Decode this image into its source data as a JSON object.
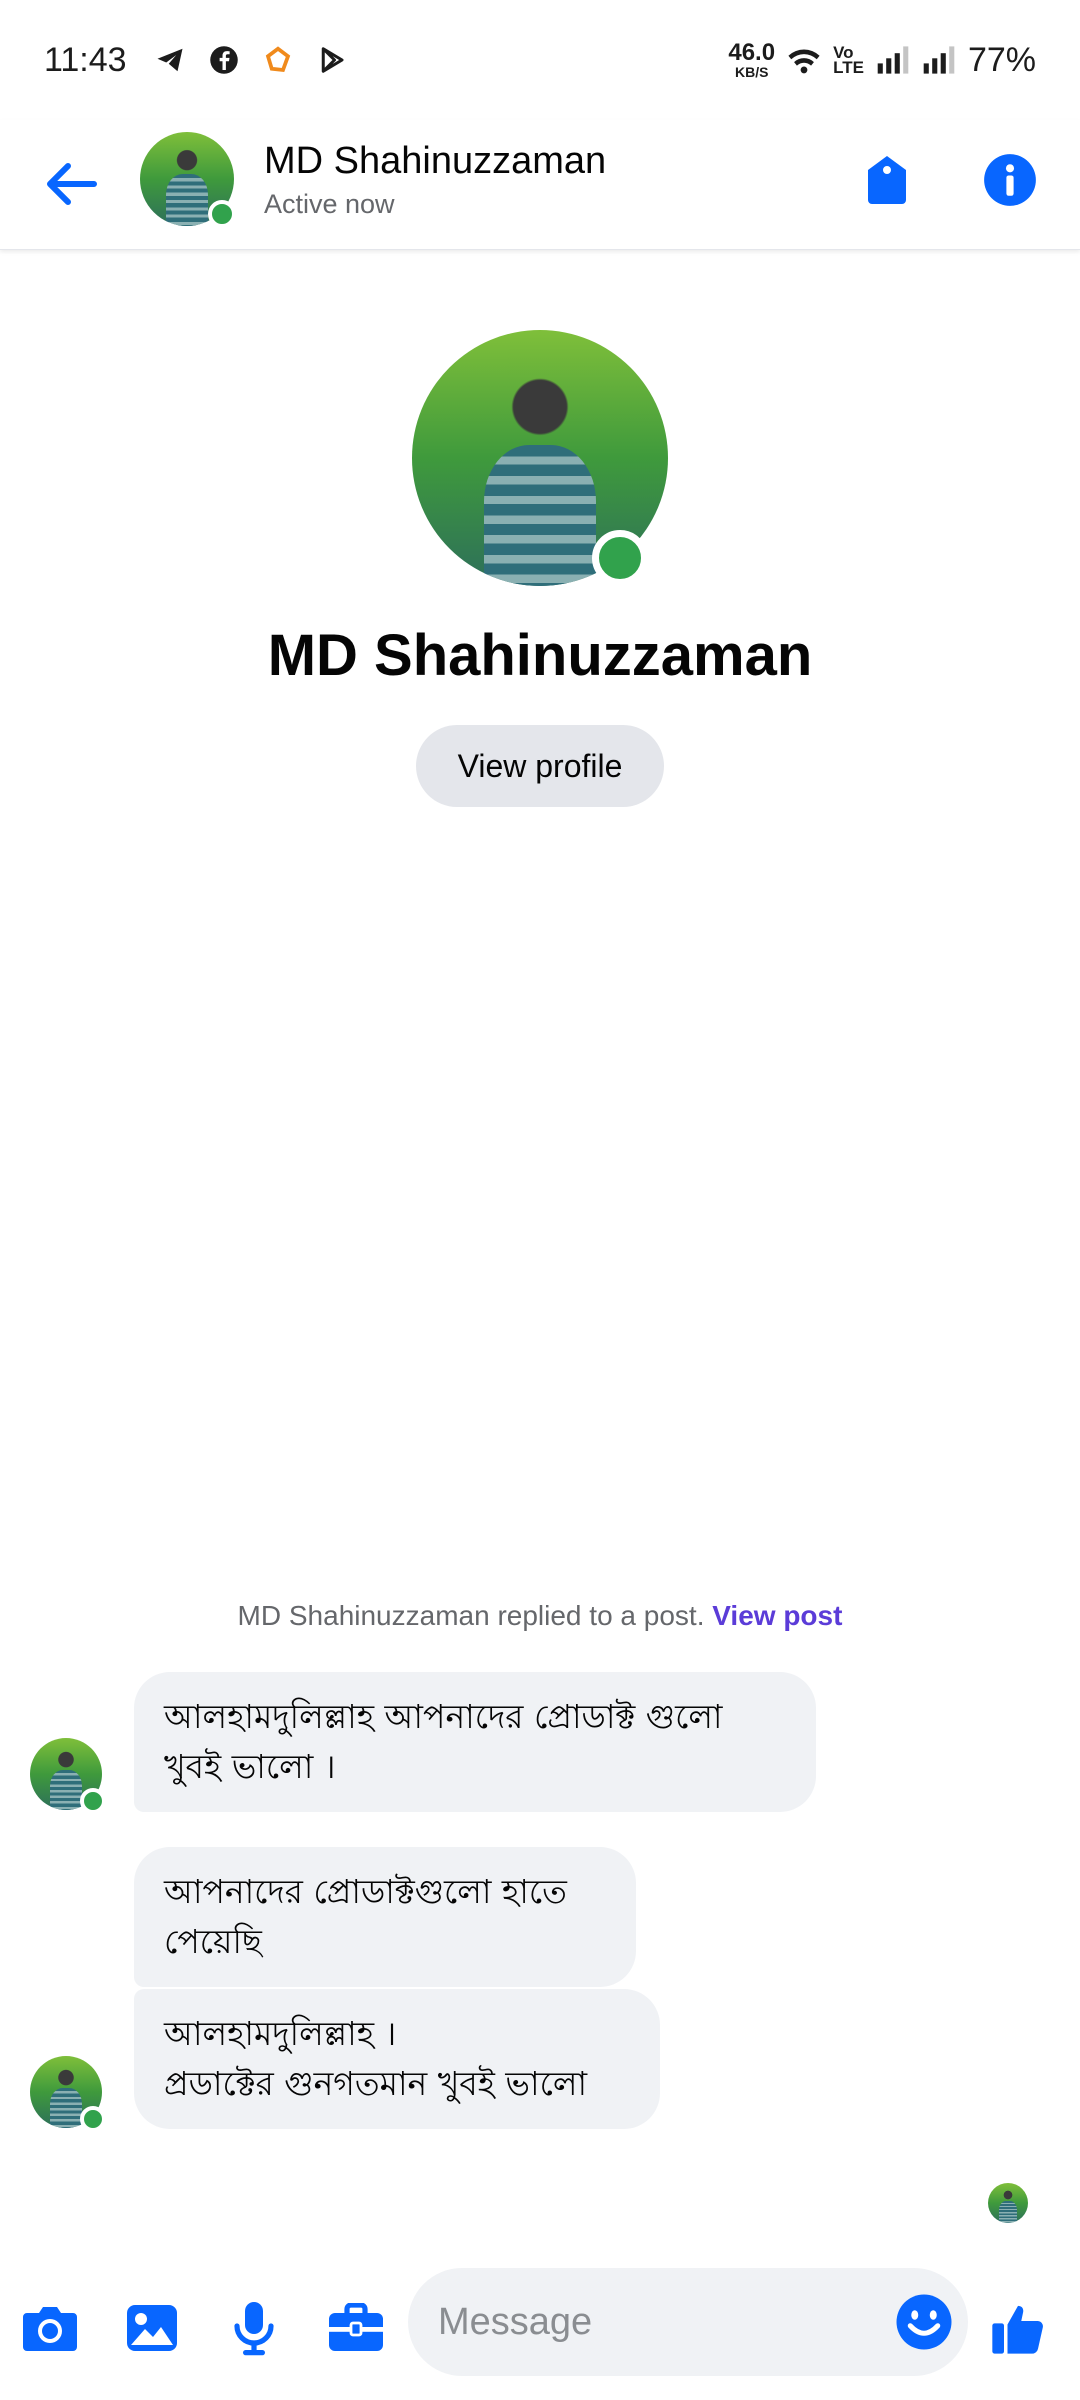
{
  "status_bar": {
    "time": "11:43",
    "net_speed_value": "46.0",
    "net_speed_unit": "KB/S",
    "volte_top": "Vo",
    "volte_bottom": "LTE",
    "battery": "77%"
  },
  "header": {
    "name": "MD Shahinuzzaman",
    "status": "Active now"
  },
  "profile": {
    "name": "MD Shahinuzzaman",
    "view_profile_label": "View profile"
  },
  "conversation": {
    "reply_note": "MD Shahinuzzaman replied to a post.",
    "view_post_label": "View post",
    "messages": [
      {
        "text": "আলহামদুলিল্লাহ আপনাদের প্রোডাক্ট গুলো খুবই ভালো ।"
      },
      {
        "text": "আপনাদের প্রোডাক্টগুলো হাতে পেয়েছি"
      },
      {
        "line1": "আলহামদুলিল্লাহ ।",
        "line2": "প্রডাক্টের গুনগতমান খুবই ভালো"
      }
    ]
  },
  "composer": {
    "placeholder": "Message"
  },
  "colors": {
    "accent": "#0866ff",
    "online": "#31a24c",
    "bubble": "#f0f2f5",
    "link": "#5b3cd8"
  }
}
